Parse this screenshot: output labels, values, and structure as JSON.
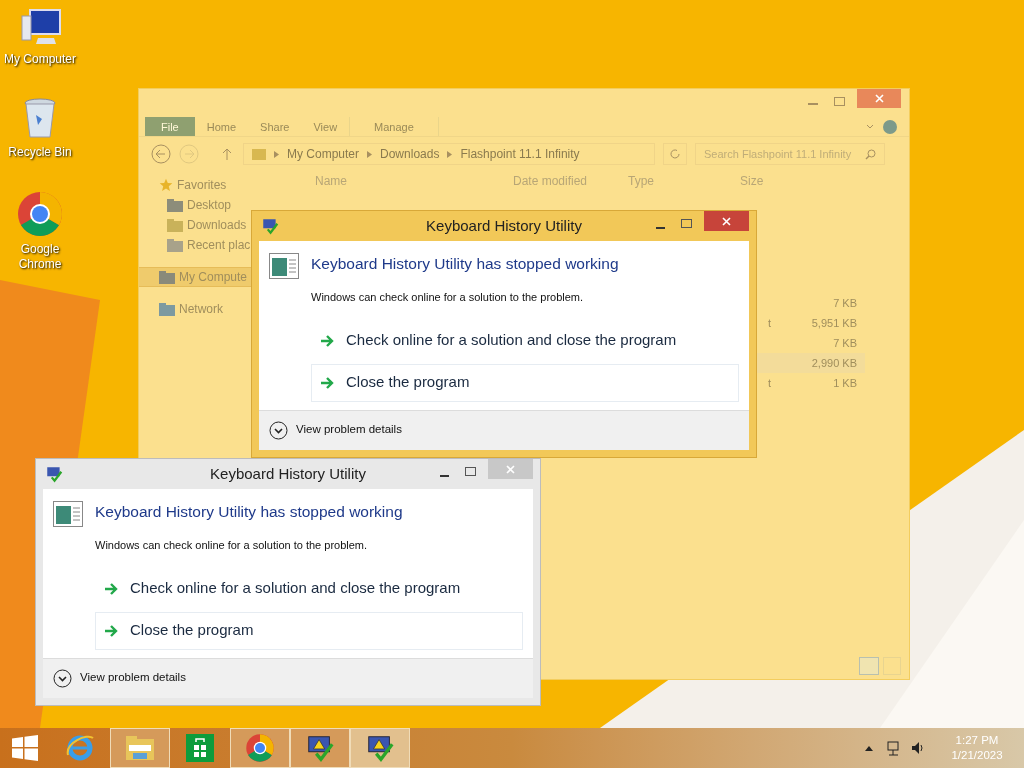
{
  "desktop_icons": [
    {
      "label": "My Computer",
      "kind": "computer"
    },
    {
      "label": "Recycle Bin",
      "kind": "bin"
    },
    {
      "label": "Google Chrome",
      "kind": "chrome"
    }
  ],
  "explorer": {
    "ribbon_tabs": [
      {
        "label": "File",
        "kind": "file"
      },
      {
        "label": "Home",
        "kind": "tab"
      },
      {
        "label": "Share",
        "kind": "tab"
      },
      {
        "label": "View",
        "kind": "tab"
      },
      {
        "label": "Manage",
        "kind": "context"
      }
    ],
    "breadcrumb": [
      "My Computer",
      "Downloads",
      "Flashpoint 11.1 Infinity"
    ],
    "search": {
      "placeholder": "Search Flashpoint 11.1 Infinity"
    },
    "columns": [
      "Name",
      "Date modified",
      "Type",
      "Size"
    ],
    "nav": [
      {
        "label": "Favorites",
        "kind": "favorites",
        "children": [
          {
            "label": "Desktop",
            "kind": "folder"
          },
          {
            "label": "Downloads",
            "kind": "download"
          },
          {
            "label": "Recent plac",
            "kind": "recent"
          }
        ]
      },
      {
        "label": "My Compute",
        "kind": "computer",
        "selected": true
      },
      {
        "label": "Network",
        "kind": "network",
        "selected": false
      }
    ],
    "rows": [
      {
        "size": "7 KB",
        "selected": false
      },
      {
        "type": "t",
        "size": "5,951 KB",
        "selected": false
      },
      {
        "size": "7 KB",
        "selected": false
      },
      {
        "size": "2,990 KB",
        "selected": true
      },
      {
        "type": "t",
        "size": "1 KB",
        "selected": false
      }
    ]
  },
  "dialogs": [
    {
      "title": "Keyboard History Utility",
      "active": true,
      "heading": "Keyboard History Utility has stopped working",
      "message": "Windows can check online for a solution to the problem.",
      "options": [
        {
          "label": "Check online for a solution and close the program",
          "selected": false
        },
        {
          "label": "Close the program",
          "selected": true
        }
      ],
      "details": "View problem details"
    },
    {
      "title": "Keyboard History Utility",
      "active": false,
      "heading": "Keyboard History Utility has stopped working",
      "message": "Windows can check online for a solution to the problem.",
      "options": [
        {
          "label": "Check online for a solution and close the program",
          "selected": false
        },
        {
          "label": "Close the program",
          "selected": true
        }
      ],
      "details": "View problem details"
    }
  ],
  "taskbar": {
    "items": [
      {
        "kind": "start",
        "running": false,
        "selected": false
      },
      {
        "kind": "ie",
        "running": false,
        "selected": false
      },
      {
        "kind": "explorer",
        "running": true,
        "selected": false
      },
      {
        "kind": "store",
        "running": false,
        "selected": false
      },
      {
        "kind": "chrome",
        "running": true,
        "selected": false
      },
      {
        "kind": "app",
        "running": true,
        "selected": false
      },
      {
        "kind": "app",
        "running": true,
        "selected": true
      }
    ],
    "clock": {
      "time": "1:27 PM",
      "date": "1/21/2023"
    }
  }
}
